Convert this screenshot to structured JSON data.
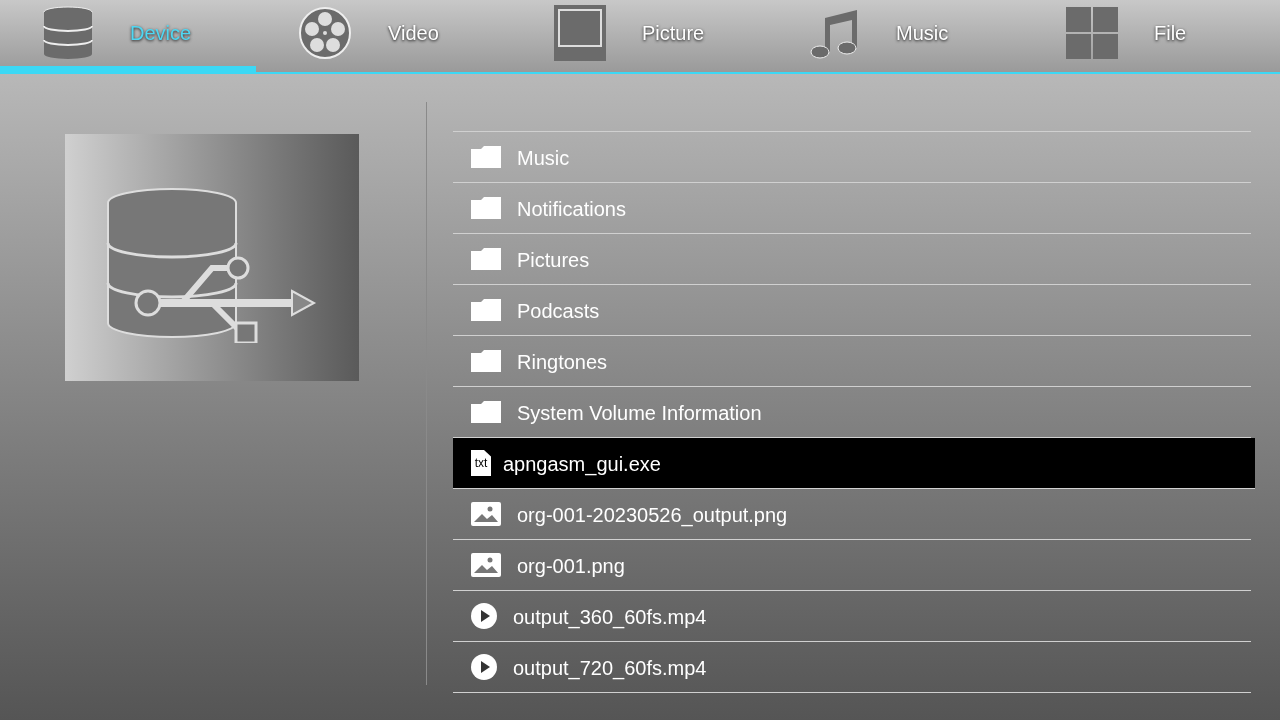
{
  "tabs": [
    {
      "label": "Device",
      "kind": "device",
      "selected": true
    },
    {
      "label": "Video",
      "kind": "video",
      "selected": false
    },
    {
      "label": "Picture",
      "kind": "picture",
      "selected": false
    },
    {
      "label": "Music",
      "kind": "music",
      "selected": false
    },
    {
      "label": "File",
      "kind": "file",
      "selected": false
    }
  ],
  "files": [
    {
      "name": "Music",
      "kind": "folder",
      "selected": false
    },
    {
      "name": "Notifications",
      "kind": "folder",
      "selected": false
    },
    {
      "name": "Pictures",
      "kind": "folder",
      "selected": false
    },
    {
      "name": "Podcasts",
      "kind": "folder",
      "selected": false
    },
    {
      "name": "Ringtones",
      "kind": "folder",
      "selected": false
    },
    {
      "name": "System Volume Information",
      "kind": "folder",
      "selected": false
    },
    {
      "name": "apngasm_gui.exe",
      "kind": "text",
      "icon_text": "txt",
      "selected": true
    },
    {
      "name": "org-001-20230526_output.png",
      "kind": "image",
      "selected": false
    },
    {
      "name": "org-001.png",
      "kind": "image",
      "selected": false
    },
    {
      "name": "output_360_60fs.mp4",
      "kind": "video",
      "selected": false
    },
    {
      "name": "output_720_60fs.mp4",
      "kind": "video",
      "selected": false
    }
  ]
}
